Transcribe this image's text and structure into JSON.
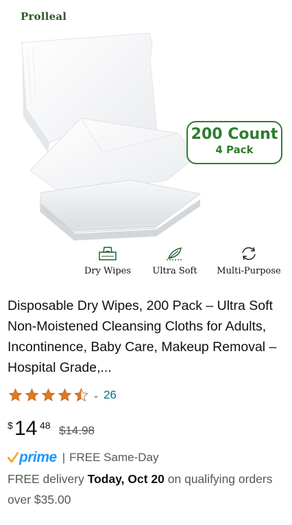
{
  "product": {
    "brand": "Prolleal",
    "badge": {
      "count": "200 Count",
      "pack": "4 Pack"
    },
    "features": [
      {
        "icon": "tissue-box-icon",
        "label": "Dry Wipes"
      },
      {
        "icon": "feather-icon",
        "label": "Ultra Soft"
      },
      {
        "icon": "cycle-arrows-icon",
        "label": "Multi-Purpose"
      }
    ],
    "title": "Disposable Dry Wipes, 200 Pack – Ultra Soft Non-Moistened Cleansing Cloths for Adults, Incontinence, Baby Care, Makeup Removal – Hospital Grade,...",
    "rating": {
      "stars": 4.5,
      "max": 5,
      "count": "26"
    },
    "price": {
      "currency": "$",
      "whole": "14",
      "fraction": "48",
      "list": "$14.98"
    },
    "prime": {
      "logo_text": "prime",
      "separator": "|",
      "shipping": "FREE Same-Day"
    },
    "delivery": {
      "prefix": "FREE delivery",
      "date": "Today, Oct 20",
      "suffix": "on qualifying orders over $35.00"
    }
  },
  "colors": {
    "brand_green": "#2e7d2e",
    "prime_blue": "#1a98ff",
    "star": "#de7921",
    "link": "#007185",
    "muted": "#565959"
  }
}
